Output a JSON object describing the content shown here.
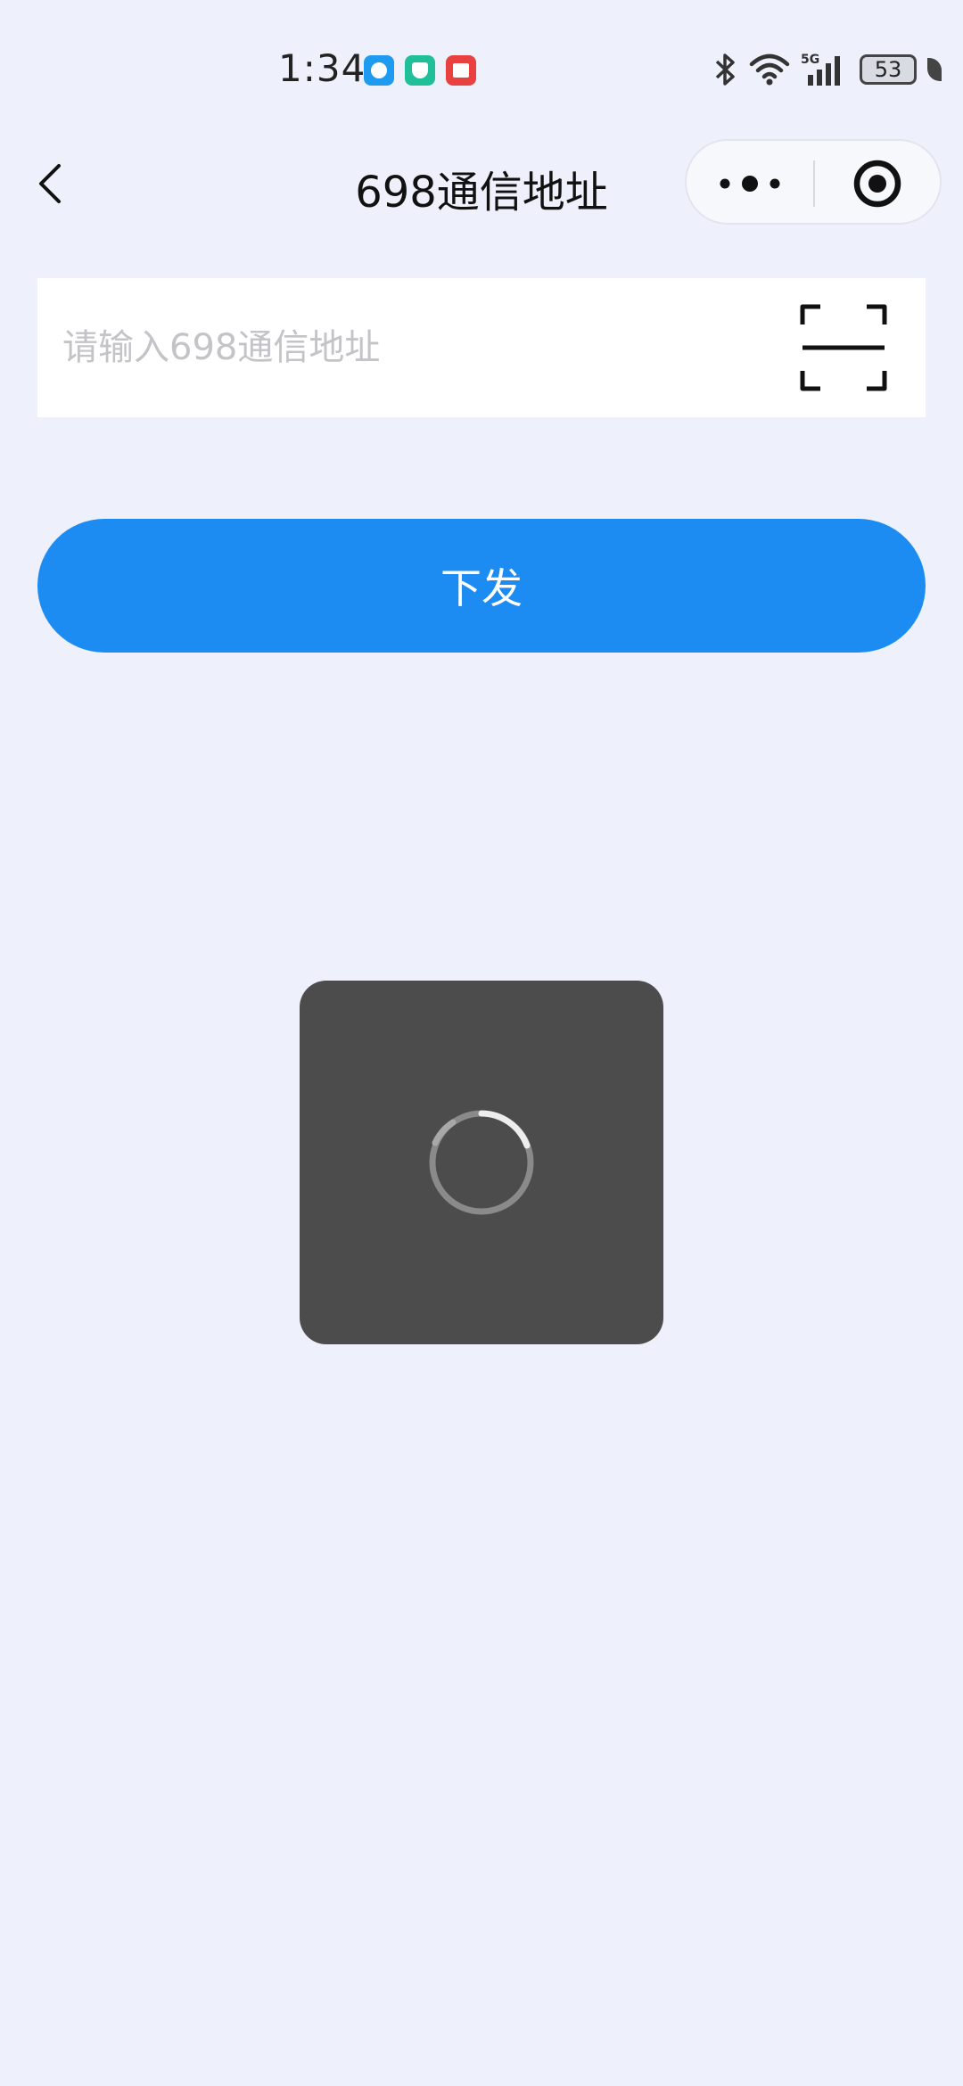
{
  "status_bar": {
    "time": "1:34",
    "battery": "53",
    "network": "5G"
  },
  "nav": {
    "title": "698通信地址"
  },
  "form": {
    "address_placeholder": "请输入698通信地址",
    "address_value": "",
    "submit_label": "下发"
  },
  "colors": {
    "background": "#eef1fb",
    "primary": "#1d8cf2",
    "toast": "#4c4c4c"
  },
  "icons": [
    "back-arrow-icon",
    "more-dots-icon",
    "close-circle-icon",
    "scan-icon",
    "loading-spinner-icon"
  ]
}
